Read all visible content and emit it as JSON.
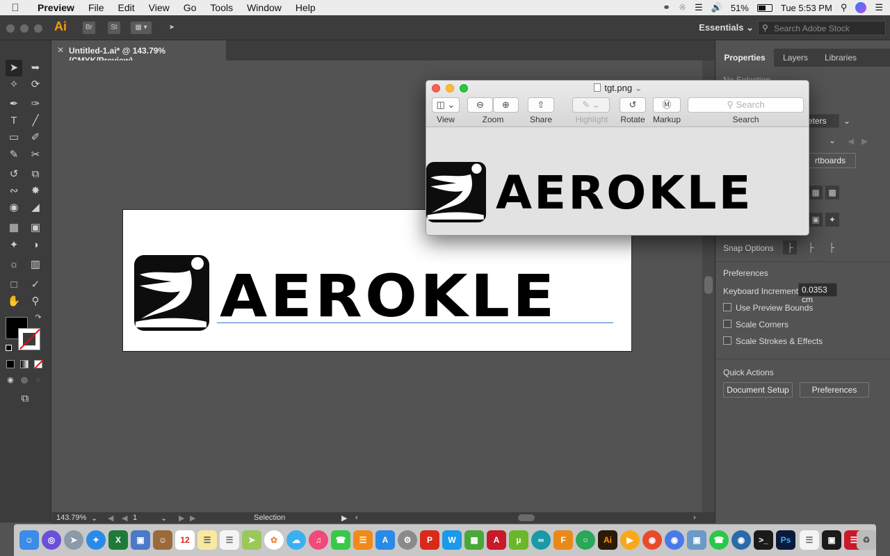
{
  "menubar": {
    "app_name": "Preview",
    "items": [
      "File",
      "Edit",
      "View",
      "Go",
      "Tools",
      "Window",
      "Help"
    ],
    "battery": "51%",
    "clock": "Tue 5:53 PM"
  },
  "appbar": {
    "app_logo": "Ai",
    "bridge": "Br",
    "stock": "St",
    "workspace": "Essentials",
    "stock_search_placeholder": "Search Adobe Stock"
  },
  "document": {
    "tab_title": "Untitled-1.ai* @ 143.79% (CMYK/Preview)",
    "logo_text": "AEROKLE"
  },
  "statusbar": {
    "zoom": "143.79%",
    "artboard_number": "1",
    "tool_name": "Selection"
  },
  "right_panel": {
    "tabs": [
      "Properties",
      "Layers",
      "Libraries"
    ],
    "no_selection": "No Selection",
    "units_partial": "eters",
    "artboards_partial": "rtboards",
    "snap_options": "Snap Options",
    "preferences_heading": "Preferences",
    "keyboard_increment_label": "Keyboard Increment:",
    "keyboard_increment_value": "0.0353 cm",
    "checks": [
      "Use Preview Bounds",
      "Scale Corners",
      "Scale Strokes & Effects"
    ],
    "quick_actions_heading": "Quick Actions",
    "document_setup_button": "Document Setup",
    "preferences_button": "Preferences"
  },
  "preview_window": {
    "title": "tgt.png",
    "view_label": "View",
    "zoom_label": "Zoom",
    "share_label": "Share",
    "highlight_label": "Highlight",
    "rotate_label": "Rotate",
    "markup_label": "Markup",
    "search_placeholder": "Search",
    "search_label": "Search",
    "logo_text": "AEROKLE"
  },
  "dock": {
    "ai_label": "Ai",
    "ps_label": "Ps"
  }
}
